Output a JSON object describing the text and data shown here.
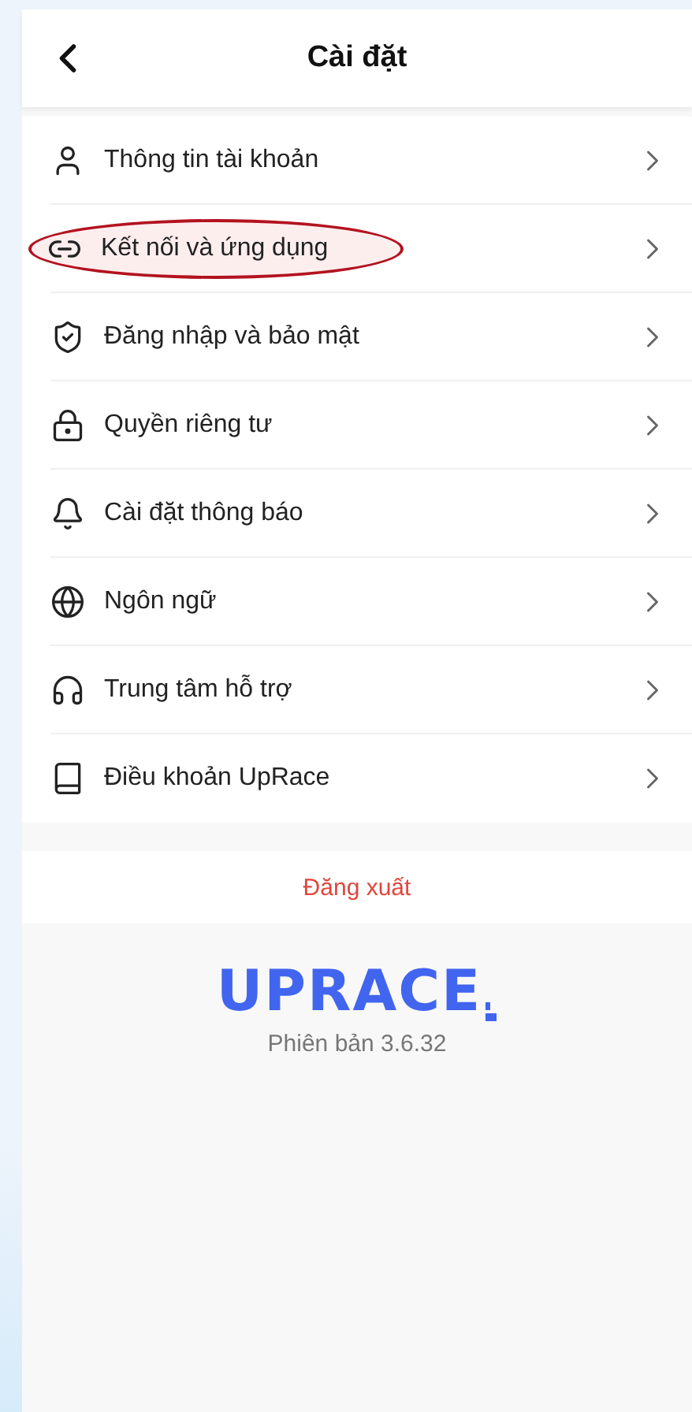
{
  "header": {
    "title": "Cài đặt"
  },
  "menu": [
    {
      "kind": "person",
      "label": "Thông tin tài khoản",
      "highlighted": false
    },
    {
      "kind": "link",
      "label": "Kết nối và ứng dụng",
      "highlighted": true
    },
    {
      "kind": "shield",
      "label": "Đăng nhập và bảo mật",
      "highlighted": false
    },
    {
      "kind": "lock",
      "label": "Quyền riêng tư",
      "highlighted": false
    },
    {
      "kind": "bell",
      "label": "Cài đặt thông báo",
      "highlighted": false
    },
    {
      "kind": "globe",
      "label": "Ngôn ngữ",
      "highlighted": false
    },
    {
      "kind": "headphones",
      "label": "Trung tâm hỗ trợ",
      "highlighted": false
    },
    {
      "kind": "book",
      "label": "Điều khoản UpRace",
      "highlighted": false
    }
  ],
  "logout": "Đăng xuất",
  "logo": "UPRACE",
  "version": "Phiên bản 3.6.32"
}
